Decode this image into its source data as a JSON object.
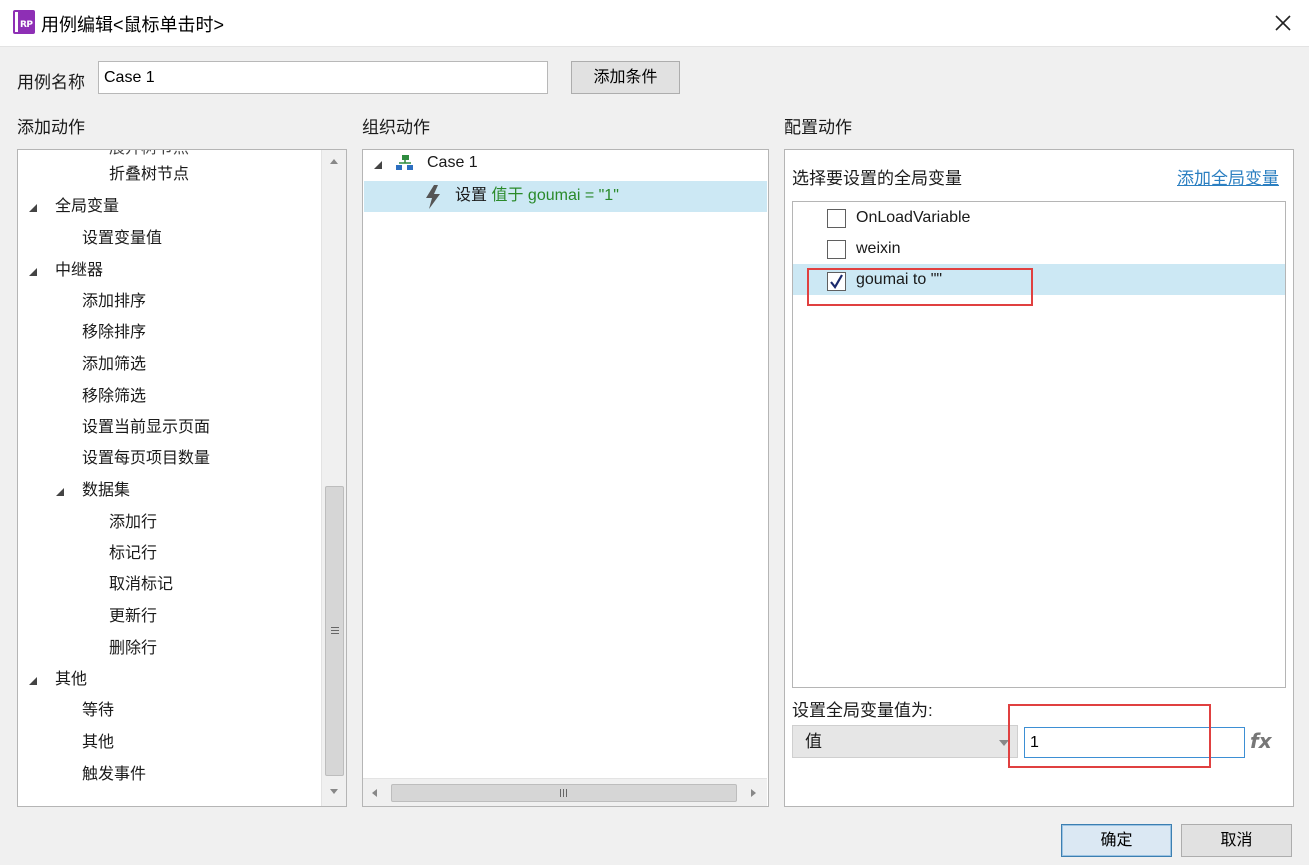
{
  "window": {
    "title": "用例编辑<鼠标单击时>"
  },
  "case_name": {
    "label": "用例名称",
    "value": "Case 1",
    "add_condition_label": "添加条件"
  },
  "add_actions": {
    "header": "添加动作",
    "items": [
      "展开树节点",
      "折叠树节点",
      "全局变量",
      "设置变量值",
      "中继器",
      "添加排序",
      "移除排序",
      "添加筛选",
      "移除筛选",
      "设置当前显示页面",
      "设置每页项目数量",
      "数据集",
      "添加行",
      "标记行",
      "取消标记",
      "更新行",
      "删除行",
      "其他",
      "等待",
      "其他",
      "触发事件"
    ]
  },
  "organize_actions": {
    "header": "组织动作",
    "case_label": "Case 1",
    "action_prefix": "设置",
    "action_detail": "值于 goumai = \"1\""
  },
  "configure_actions": {
    "header": "配置动作",
    "select_label": "选择要设置的全局变量",
    "add_global_link": "添加全局变量",
    "variables": [
      {
        "name": "OnLoadVariable",
        "checked": false
      },
      {
        "name": "weixin",
        "checked": false
      },
      {
        "name": "goumai to \"\"",
        "checked": true
      }
    ],
    "set_value_label": "设置全局变量值为:",
    "value_type": "值",
    "value": "1",
    "fx_label": "fx"
  },
  "footer": {
    "ok_label": "确定",
    "cancel_label": "取消"
  },
  "colors": {
    "accent_green": "#2a8a2a",
    "selection": "#cce8f4",
    "highlight_red": "#e04040",
    "link_blue": "#2b7fc1"
  }
}
